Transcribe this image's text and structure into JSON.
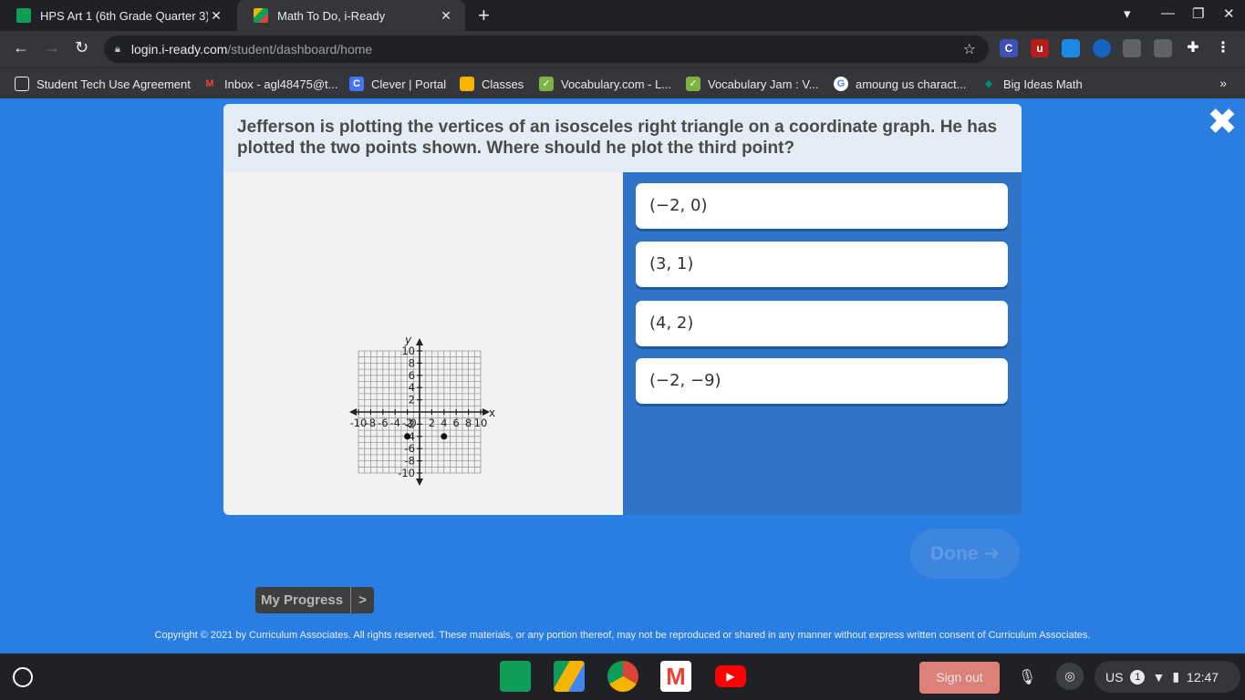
{
  "browser": {
    "tabs": [
      {
        "title": "HPS Art 1 (6th Grade Quarter 3) S",
        "close": "✕"
      },
      {
        "title": "Math To Do, i-Ready",
        "close": "✕"
      }
    ],
    "new_tab": "+",
    "url_host": "login.i-ready.com",
    "url_path": "/student/dashboard/home",
    "extensions": [
      {
        "label": "C",
        "color": "#3f51b5"
      },
      {
        "label": "u",
        "color": "#b71c1c"
      },
      {
        "label": "2",
        "color": "#5f6368"
      }
    ],
    "bookmarks": [
      {
        "label": "Student Tech Use Agreement",
        "icon": "folder-icon"
      },
      {
        "label": "Inbox - agl48475@t...",
        "icon": "gmail-icon"
      },
      {
        "label": "Clever | Portal",
        "icon": "clever-icon"
      },
      {
        "label": "Classes",
        "icon": "classroom-icon"
      },
      {
        "label": "Vocabulary.com - L...",
        "icon": "vocabulary-icon"
      },
      {
        "label": "Vocabulary Jam : V...",
        "icon": "vocabulary-icon"
      },
      {
        "label": "amoung us charact...",
        "icon": "google-icon"
      },
      {
        "label": "Big Ideas Math",
        "icon": "bigideas-icon"
      }
    ],
    "more": "»"
  },
  "lesson": {
    "question": "Jefferson is plotting the vertices of an isosceles right triangle on a coordinate graph. He has plotted the two points shown. Where should he plot the third point?",
    "answers": [
      "(−2, 0)",
      "(3, 1)",
      "(4, 2)",
      "(−2, −9)"
    ],
    "done_label": "Done ➔",
    "close_label": "✖"
  },
  "graph": {
    "x_label": "x",
    "y_label": "y",
    "x_range": [
      -10,
      10
    ],
    "y_range": [
      -10,
      10
    ],
    "grid": true,
    "x_tick_labels": [
      "-10",
      "-8",
      "-6",
      "-4",
      "-2",
      "0",
      "2",
      "4",
      "6",
      "8",
      "10"
    ],
    "y_tick_labels": [
      "10",
      "8",
      "6",
      "4",
      "2",
      "-2",
      "-4",
      "-6",
      "-8",
      "-10"
    ],
    "points": [
      {
        "x": -2,
        "y": -4
      },
      {
        "x": 4,
        "y": -4
      }
    ]
  },
  "footer": {
    "progress_label": "My Progress",
    "progress_chevron": ">",
    "copyright": "Copyright © 2021 by Curriculum Associates. All rights reserved. These materials, or any portion thereof, may not be reproduced or shared in any manner without express written consent of Curriculum Associates."
  },
  "shelf": {
    "sign_out": "Sign out",
    "locale": "US",
    "notifications": "1",
    "time": "12:47"
  }
}
